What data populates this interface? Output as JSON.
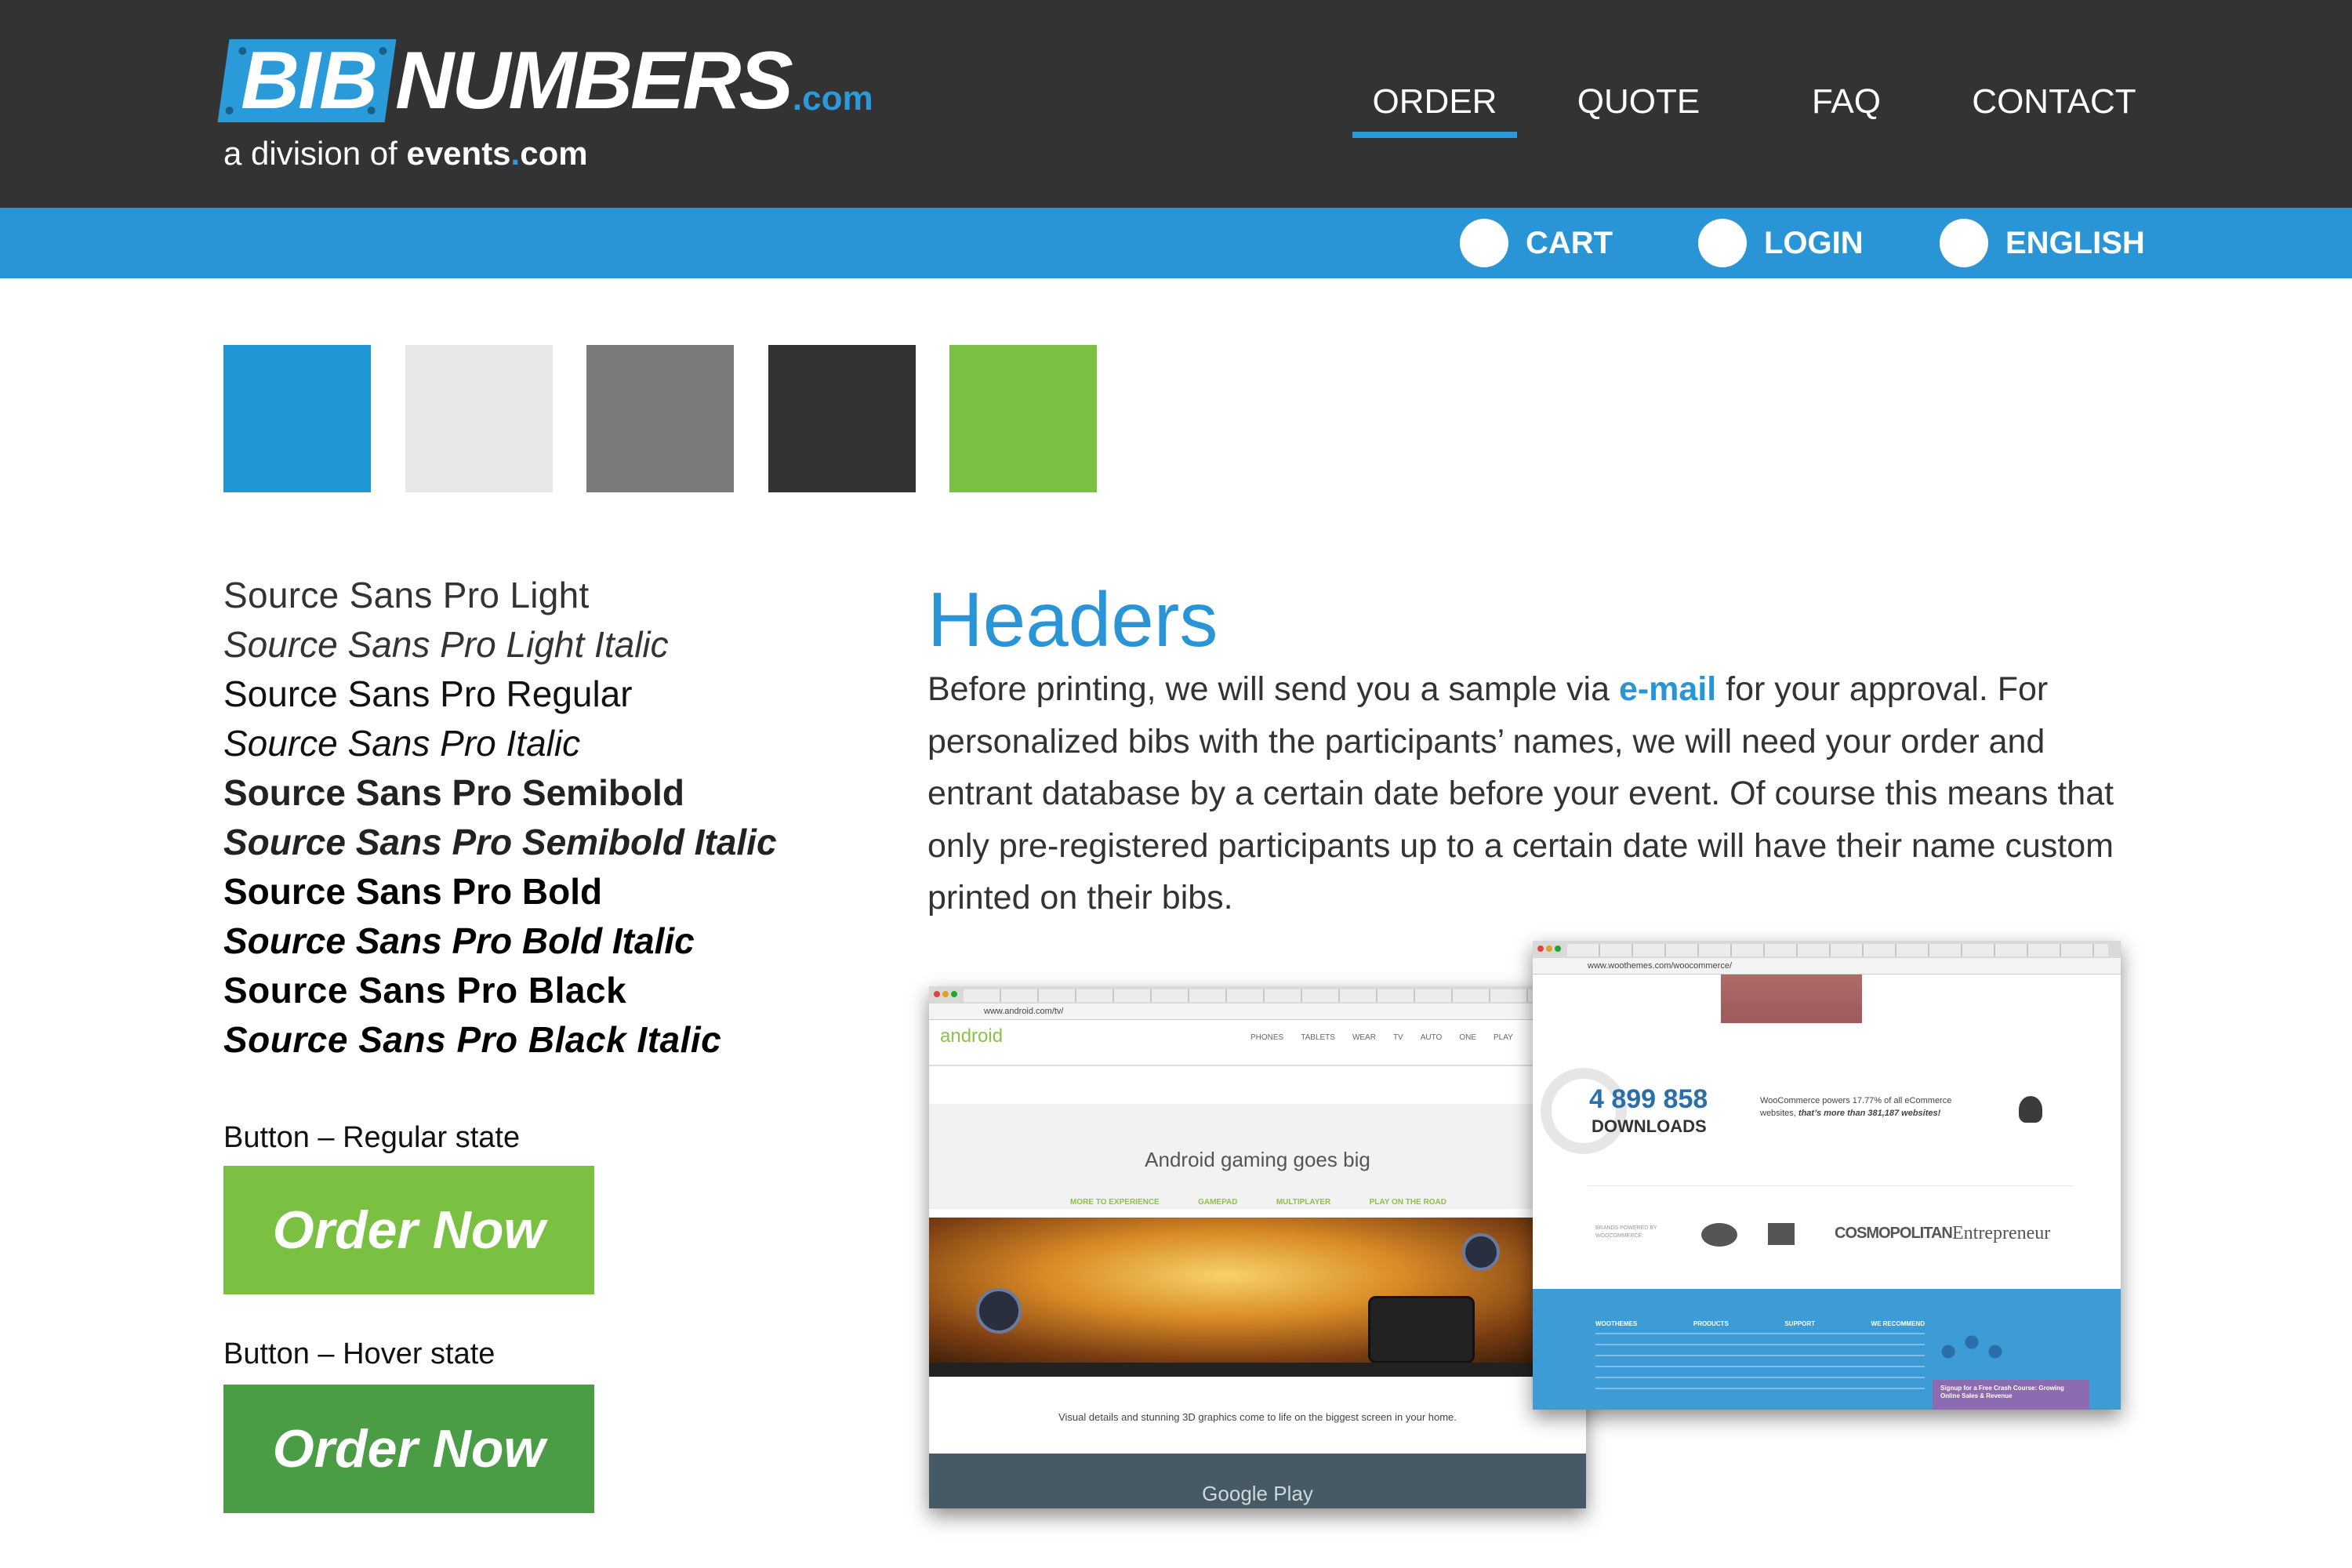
{
  "brand": {
    "logo_bib": "BIB",
    "logo_numbers": "NUMBERS",
    "logo_com": ".com",
    "logo_sub_prefix": "a division of ",
    "logo_sub_events": "events",
    "logo_sub_dot": ".",
    "logo_sub_com": "com"
  },
  "nav": {
    "items": [
      "ORDER",
      "QUOTE",
      "FAQ",
      "CONTACT"
    ],
    "active": "ORDER"
  },
  "subnav": {
    "items": [
      "CART",
      "LOGIN",
      "ENGLISH"
    ]
  },
  "colors": {
    "swatches": [
      "#2196d6",
      "#e8e8e8",
      "#7a7a7a",
      "#333333",
      "#7ac143"
    ],
    "header_bg": "#333333",
    "accent_blue": "#2a95d6",
    "button_regular": "#7ac143",
    "button_hover": "#4a9c45"
  },
  "typography": {
    "samples": [
      "Source Sans Pro Light",
      "Source Sans Pro Light Italic",
      "Source Sans Pro Regular",
      "Source Sans Pro Italic",
      "Source Sans Pro Semibold",
      "Source Sans Pro Semibold Italic",
      "Source Sans Pro Bold",
      "Source Sans Pro Bold Italic",
      "Source Sans Pro Black",
      "Source Sans Pro Black Italic"
    ]
  },
  "buttons": {
    "regular_caption": "Button – Regular state",
    "hover_caption": "Button – Hover state",
    "label": "Order Now"
  },
  "headers": {
    "title": "Headers",
    "para_before_link": "Before printing, we will send you a sample via ",
    "link": "e-mail",
    "para_after_link": " for your approval. For personalized bibs with the participants’ names, we will need your order and entrant database by a certain date before your event. Of course this means that only pre-registered participants up to a certain date will have their name custom printed on their bibs."
  },
  "screenshot_android": {
    "url": "www.android.com/tv/",
    "logo": "android",
    "menu": [
      "PHONES",
      "TABLETS",
      "WEAR",
      "TV",
      "AUTO",
      "ONE",
      "PLAY"
    ],
    "headline": "Android gaming goes big",
    "subnav": [
      "MORE TO EXPERIENCE",
      "GAMEPAD",
      "MULTIPLAYER",
      "PLAY ON THE ROAD"
    ],
    "caption": "Visual details and stunning 3D graphics come to life on the biggest screen in your home.",
    "footer": "Google Play"
  },
  "screenshot_woo": {
    "url": "www.woothemes.com/woocommerce/",
    "downloads_number": "4 899 858",
    "downloads_label": "DOWNLOADS",
    "powers_text": "WooCommerce powers 17.77% of all eCommerce websites,",
    "powers_emph": "that’s more than 381,187 websites!",
    "brands_label": "BRANDS POWERED BY WOOCOMMERCE:",
    "brands": [
      "COSMOPOLITAN",
      "Entrepreneur"
    ],
    "footer_heads": [
      "WOOTHEMES",
      "PRODUCTS",
      "SUPPORT",
      "WE RECOMMEND"
    ],
    "promo": "Signup for a Free Crash Course: Growing Online Sales & Revenue"
  }
}
